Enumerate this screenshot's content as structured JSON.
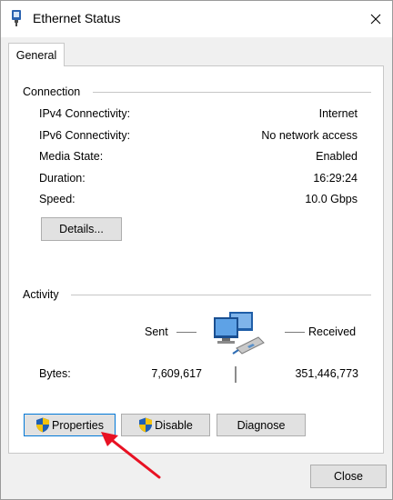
{
  "window": {
    "title": "Ethernet Status"
  },
  "tabs": [
    {
      "label": "General"
    }
  ],
  "connection": {
    "title": "Connection",
    "rows": [
      {
        "label": "IPv4 Connectivity:",
        "value": "Internet"
      },
      {
        "label": "IPv6 Connectivity:",
        "value": "No network access"
      },
      {
        "label": "Media State:",
        "value": "Enabled"
      },
      {
        "label": "Duration:",
        "value": "16:29:24"
      },
      {
        "label": "Speed:",
        "value": "10.0 Gbps"
      }
    ],
    "details_button": "Details..."
  },
  "activity": {
    "title": "Activity",
    "sent_label": "Sent",
    "received_label": "Received",
    "bytes_label": "Bytes:",
    "bytes_sent": "7,609,617",
    "bytes_received": "351,446,773"
  },
  "buttons": {
    "properties": "Properties",
    "disable": "Disable",
    "diagnose": "Diagnose",
    "close": "Close"
  },
  "icons": {
    "title": "ethernet-adapter-icon",
    "network": "network-computers-icon",
    "shield": "uac-shield-icon",
    "annotation": "red-arrow-annotation"
  },
  "colors": {
    "accent": "#0078d7",
    "annotation": "#e81123"
  }
}
